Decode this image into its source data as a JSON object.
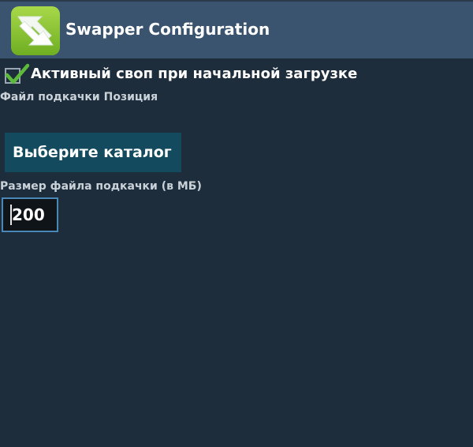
{
  "window": {
    "title": "Swapper Configuration",
    "icon": "swapper-app-icon"
  },
  "colors": {
    "background": "#1e2d3b",
    "title_bar": "#3a536e",
    "button": "#134a5e",
    "input_border": "#4a88b8",
    "checkmark": "#5dbb3c"
  },
  "settings": {
    "active_swap_on_boot": {
      "label": "Активный своп при начальной загрузке",
      "checked": true
    },
    "swap_file_position": {
      "label": "Файл подкачки Позиция",
      "button_label": "Выберите каталог"
    },
    "swap_file_size": {
      "label": "Размер файла подкачки (в МБ)",
      "value": "200"
    }
  }
}
